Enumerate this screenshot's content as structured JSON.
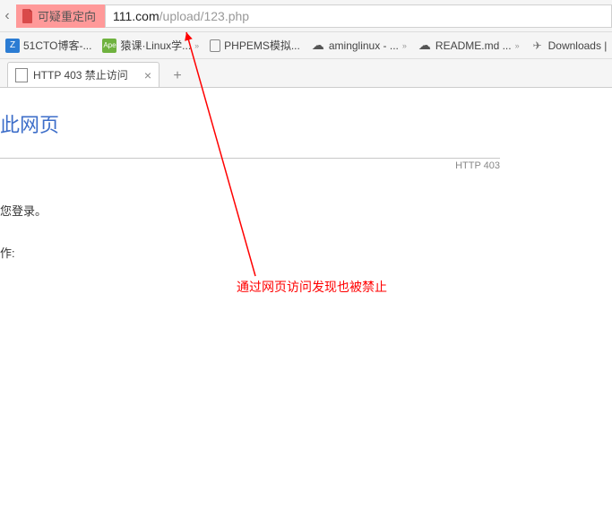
{
  "address": {
    "warning_label": "可疑重定向",
    "url_host": "111.com",
    "url_path": "/upload/123.php"
  },
  "bookmarks": [
    {
      "label": "51CTO博客-...",
      "icon_name": "favicon-51cto"
    },
    {
      "label": "猿课·Linux学...",
      "icon_name": "favicon-ape"
    },
    {
      "label": "PHPEMS模拟...",
      "icon_name": "favicon-page"
    },
    {
      "label": "aminglinux - ...",
      "icon_name": "favicon-cloud"
    },
    {
      "label": "README.md ...",
      "icon_name": "favicon-cloud"
    },
    {
      "label": "Downloads |",
      "icon_name": "favicon-plane"
    }
  ],
  "tab": {
    "title": "HTTP 403 禁止访问"
  },
  "page": {
    "heading": "此网页",
    "error_code": "HTTP 403",
    "line1": "您登录。",
    "line2": "作:"
  },
  "annotation": {
    "text": "通过网页访问发现也被禁止"
  }
}
